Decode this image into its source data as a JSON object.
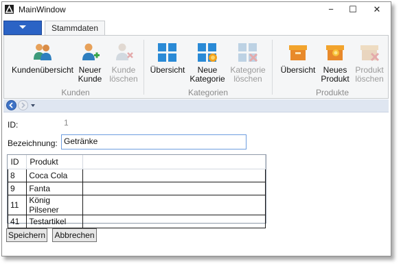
{
  "window": {
    "title": "MainWindow",
    "minimize_glyph": "−",
    "maximize_glyph": "☐",
    "close_glyph": "✕"
  },
  "ribbon": {
    "tab_label": "Stammdaten",
    "groups": [
      {
        "label": "Kunden",
        "buttons": [
          {
            "label": "Kundenübersicht",
            "icon": "users-icon",
            "enabled": true
          },
          {
            "label_line1": "Neuer",
            "label_line2": "Kunde",
            "icon": "user-add-icon",
            "enabled": true
          },
          {
            "label_line1": "Kunde",
            "label_line2": "löschen",
            "icon": "user-delete-icon",
            "enabled": false
          }
        ]
      },
      {
        "label": "Kategorien",
        "buttons": [
          {
            "label": "Übersicht",
            "icon": "grid-icon",
            "enabled": true
          },
          {
            "label_line1": "Neue",
            "label_line2": "Kategorie",
            "icon": "grid-add-icon",
            "enabled": true
          },
          {
            "label_line1": "Kategorie",
            "label_line2": "löschen",
            "icon": "grid-delete-icon",
            "enabled": false
          }
        ]
      },
      {
        "label": "Produkte",
        "buttons": [
          {
            "label": "Übersicht",
            "icon": "box-icon",
            "enabled": true
          },
          {
            "label_line1": "Neues",
            "label_line2": "Produkt",
            "icon": "box-add-icon",
            "enabled": true
          },
          {
            "label_line1": "Produkt",
            "label_line2": "löschen",
            "icon": "box-delete-icon",
            "enabled": false
          }
        ]
      }
    ]
  },
  "form": {
    "id_label": "ID:",
    "id_value": "1",
    "name_label": "Bezeichnung:",
    "name_value": "Getränke"
  },
  "grid": {
    "columns": [
      "ID",
      "Produkt"
    ],
    "rows": [
      {
        "id": "8",
        "product": "Coca Cola"
      },
      {
        "id": "9",
        "product": "Fanta"
      },
      {
        "id": "11",
        "product": "König Pilsener"
      },
      {
        "id": "41",
        "product": "Testartikel"
      }
    ]
  },
  "actions": {
    "save_label": "Speichern",
    "cancel_label": "Abbrechen"
  },
  "colors": {
    "accent": "#2b63c5",
    "ribbon_bg": "#f5f6f7",
    "input_border": "#6d9ddf",
    "disabled_text": "#9a9a9a"
  }
}
